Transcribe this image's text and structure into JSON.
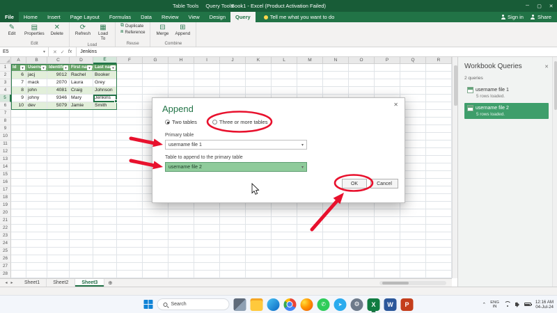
{
  "colors": {
    "titlebar_green": "#185C37",
    "ribbon_green": "#217346",
    "table_header_green": "#66A266",
    "banded_row_green": "#E2EFDA",
    "selected_query_green": "#3E9E6B",
    "append_dropdown_green": "#8FCB9B",
    "annotation_red": "#E8112D"
  },
  "icons": {
    "minimize": "─",
    "maximize": "▢",
    "close": "✕",
    "dropdown_caret": "▾",
    "filter_caret": "▾",
    "cancel_x": "✕",
    "check": "✓",
    "fx": "fx",
    "add_sheet": "⊕",
    "nav_left": "◂",
    "nav_right": "▸",
    "tray_chevron": "⌃"
  },
  "titlebar": {
    "context_tools": [
      "Table Tools",
      "Query Tools"
    ],
    "title": "Book1 - Excel (Product Activation Failed)"
  },
  "ribbon": {
    "tabs": [
      {
        "label": "File",
        "file": true
      },
      {
        "label": "Home"
      },
      {
        "label": "Insert"
      },
      {
        "label": "Page Layout"
      },
      {
        "label": "Formulas"
      },
      {
        "label": "Data"
      },
      {
        "label": "Review"
      },
      {
        "label": "View"
      },
      {
        "label": "Design"
      },
      {
        "label": "Query",
        "active": true
      }
    ],
    "tell_me": "Tell me what you want to do",
    "sign_in": "Sign in",
    "share": "Share",
    "groups": [
      {
        "label": "Edit",
        "size": "large",
        "buttons": [
          {
            "label": "Edit",
            "icon": "✎"
          },
          {
            "label": "Properties",
            "icon": "▤"
          },
          {
            "label": "Delete",
            "icon": "✕"
          }
        ]
      },
      {
        "label": "Load",
        "size": "large",
        "buttons": [
          {
            "label": "Refresh",
            "icon": "⟳"
          },
          {
            "label": "Load\nTo",
            "icon": "▦"
          }
        ]
      },
      {
        "label": "Reuse",
        "size": "small",
        "buttons": [
          {
            "label": "Duplicate",
            "icon": "⧉"
          },
          {
            "label": "Reference",
            "icon": "⧈"
          }
        ]
      },
      {
        "label": "Combine",
        "size": "large",
        "buttons": [
          {
            "label": "Merge",
            "icon": "⊟"
          },
          {
            "label": "Append",
            "icon": "⊞"
          }
        ]
      }
    ]
  },
  "grid": {
    "name_box": "E5",
    "formula_value": "Jenkins",
    "col_headers": [
      "A",
      "B",
      "C",
      "D",
      "E",
      "F",
      "G",
      "H",
      "I",
      "J",
      "K",
      "L",
      "M",
      "N",
      "O",
      "P",
      "Q",
      "R"
    ],
    "row_count": 28,
    "selected": {
      "col": "E",
      "row": 5
    },
    "table": {
      "headers": [
        "Id",
        "Username",
        "Identifier",
        "First name",
        "Last name"
      ],
      "rows": [
        [
          "6",
          "jacj",
          "9012",
          "Rachel",
          "Booker"
        ],
        [
          "7",
          "mack",
          "2070",
          "Laura",
          "Grey"
        ],
        [
          "8",
          "john",
          "4081",
          "Craig",
          "Johnson"
        ],
        [
          "9",
          "johny",
          "9346",
          "Mary",
          "Jenkins"
        ],
        [
          "10",
          "dev",
          "5079",
          "Jamie",
          "Smith"
        ]
      ],
      "numeric_cols": [
        0,
        2
      ]
    }
  },
  "dialog": {
    "title": "Append",
    "two_tables": "Two tables",
    "three_tables": "Three or more tables",
    "primary_label": "Primary table",
    "primary_value": "username file 1",
    "append_label": "Table to append to the primary table",
    "append_value": "username file 2",
    "ok": "OK",
    "cancel": "Cancel"
  },
  "queries_pane": {
    "title": "Workbook Queries",
    "count": "2 queries",
    "items": [
      {
        "name": "username file 1",
        "detail": "5 rows loaded.",
        "selected": false
      },
      {
        "name": "username file 2",
        "detail": "5 rows loaded.",
        "selected": true
      }
    ]
  },
  "sheet_bar": {
    "tabs": [
      {
        "name": "Sheet1",
        "active": false
      },
      {
        "name": "Sheet2",
        "active": false
      },
      {
        "name": "Sheet3",
        "active": true
      }
    ]
  },
  "taskbar": {
    "search_label": "Search",
    "apps": [
      {
        "name": "task-view"
      },
      {
        "name": "file-explorer"
      },
      {
        "name": "edge"
      },
      {
        "name": "chrome"
      },
      {
        "name": "firefox"
      },
      {
        "name": "whatsapp",
        "glyph": "✆"
      },
      {
        "name": "telegram",
        "glyph": "➤"
      },
      {
        "name": "settings",
        "glyph": "⚙"
      },
      {
        "name": "excel",
        "glyph": "X",
        "active": true
      },
      {
        "name": "word",
        "glyph": "W"
      },
      {
        "name": "powerpoint",
        "glyph": "P"
      }
    ],
    "tray": {
      "lang_top": "ENG",
      "lang_bottom": "IN",
      "time": "12:16 AM",
      "date": "04-Jul-24"
    }
  }
}
